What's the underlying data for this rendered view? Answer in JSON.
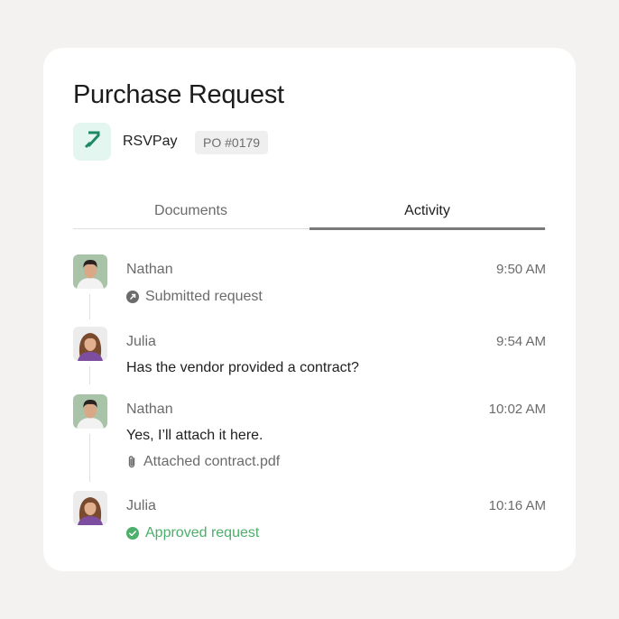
{
  "card": {
    "title": "Purchase Request",
    "vendor": {
      "name": "RSVPay",
      "logo_icon": "arrow-up-right-icon",
      "logo_bg": "#e3f6ef",
      "logo_color": "#1e8a64"
    },
    "po_number": "PO #0179"
  },
  "tabs": [
    {
      "label": "Documents",
      "active": false
    },
    {
      "label": "Activity",
      "active": true
    }
  ],
  "activity": [
    {
      "author": "Nathan",
      "time": "9:50 AM",
      "lines": [
        {
          "icon": "submit-arrow-icon",
          "text": "Submitted request",
          "style": "muted"
        }
      ]
    },
    {
      "author": "Julia",
      "time": "9:54 AM",
      "lines": [
        {
          "text": "Has the vendor provided a contract?",
          "style": "dark"
        }
      ]
    },
    {
      "author": "Nathan",
      "time": "10:02 AM",
      "lines": [
        {
          "text": "Yes, I’ll attach it here.",
          "style": "dark"
        },
        {
          "icon": "paperclip-icon",
          "text": "Attached contract.pdf",
          "style": "muted"
        }
      ]
    },
    {
      "author": "Julia",
      "time": "10:16 AM",
      "lines": [
        {
          "icon": "check-circle-icon",
          "text": "Approved request",
          "style": "green"
        }
      ]
    }
  ],
  "colors": {
    "approved": "#4caf6a",
    "background": "#f3f2f0"
  }
}
